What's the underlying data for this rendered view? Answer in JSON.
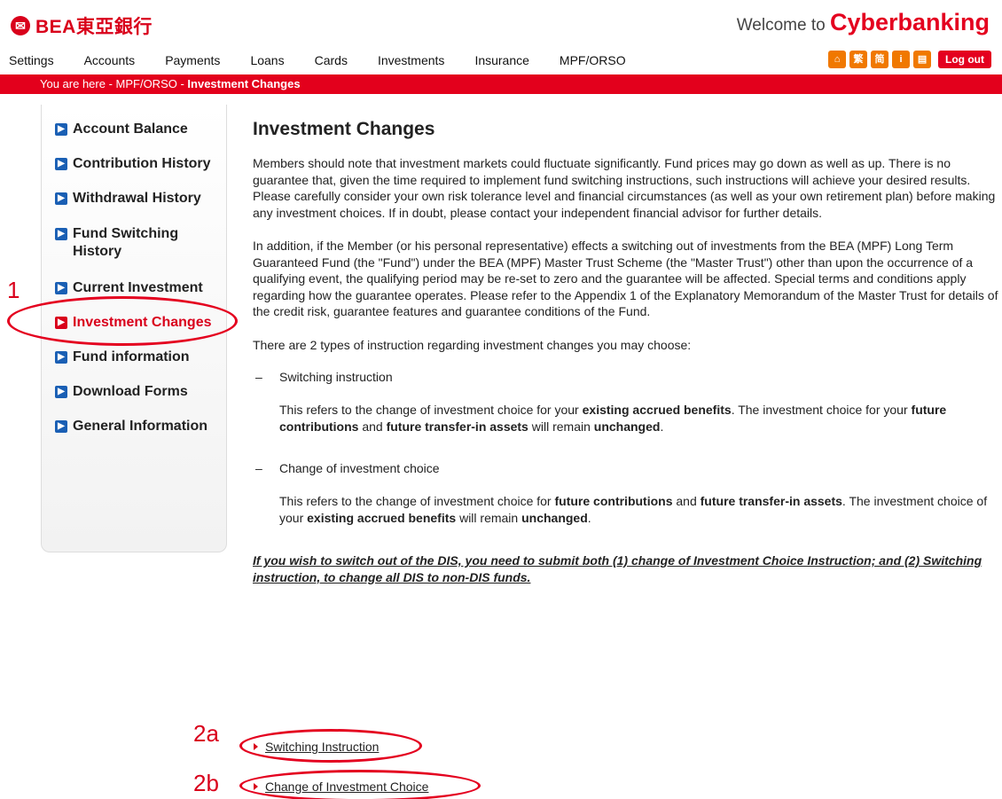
{
  "header": {
    "logo_mark": "✉",
    "logo_text": "BEA東亞銀行",
    "welcome_prefix": "Welcome to ",
    "welcome_brand": "Cyberbanking"
  },
  "nav": [
    "Settings",
    "Accounts",
    "Payments",
    "Loans",
    "Cards",
    "Investments",
    "Insurance",
    "MPF/ORSO"
  ],
  "toolbar": {
    "icons": [
      {
        "name": "home-icon",
        "glyph": "⌂"
      },
      {
        "name": "traditional-chinese-icon",
        "glyph": "繁"
      },
      {
        "name": "simplified-chinese-icon",
        "glyph": "简"
      },
      {
        "name": "info-icon",
        "glyph": "i"
      },
      {
        "name": "mailbox-icon",
        "glyph": "▤"
      }
    ],
    "logout_label": "Log out"
  },
  "breadcrumb": {
    "prefix": "You are here - MPF/ORSO - ",
    "current": "Investment Changes"
  },
  "sidebar": {
    "items": [
      {
        "label": "Account Balance"
      },
      {
        "label": "Contribution History"
      },
      {
        "label": "Withdrawal History"
      },
      {
        "label": "Fund Switching History"
      },
      {
        "label": "Current Investment"
      },
      {
        "label": "Investment Changes",
        "active": true
      },
      {
        "label": "Fund information"
      },
      {
        "label": "Download Forms"
      },
      {
        "label": "General Information"
      }
    ]
  },
  "main": {
    "title": "Investment Changes",
    "para1": "Members should note that investment markets could fluctuate significantly. Fund prices may go down as well as up. There is no guarantee that, given the time required to implement fund switching instructions, such instructions will achieve your desired results. Please carefully consider your own risk tolerance level and financial circumstances (as well as your own retirement plan) before making any investment choices. If in doubt, please contact your independent financial advisor for further details.",
    "para2": "In addition, if the Member (or his personal representative) effects a switching out of investments from the BEA (MPF) Long Term Guaranteed Fund (the \"Fund\") under the BEA (MPF) Master Trust Scheme (the \"Master Trust\") other than upon the occurrence of a qualifying event, the qualifying period may be re-set to zero and the guarantee will be affected. Special terms and conditions apply regarding how the guarantee operates. Please refer to the Appendix 1 of the Explanatory Memorandum of the Master Trust for details of the credit risk, guarantee features and guarantee conditions of the Fund.",
    "para3": "There are 2 types of instruction regarding investment changes you may choose:",
    "bullet1": "Switching instruction",
    "bullet1_desc": {
      "t1": "This refers to the change of investment choice for your ",
      "b1": "existing accrued benefits",
      "t2": ". The investment choice for your ",
      "b2": "future contributions",
      "t3": " and ",
      "b3": "future transfer-in assets",
      "t4": " will remain ",
      "b4": "unchanged",
      "t5": "."
    },
    "bullet2": "Change of investment choice",
    "bullet2_desc": {
      "t1": "This refers to the change of investment choice for ",
      "b1": "future contributions",
      "t2": " and ",
      "b2": "future transfer-in assets",
      "t3": ". The investment choice of your ",
      "b3": "existing accrued benefits",
      "t4": " will remain ",
      "b4": "unchanged",
      "t5": "."
    },
    "notice": "If you wish to switch out of the DIS, you need to submit both (1) change of Investment Choice Instruction; and (2) Switching instruction, to change all DIS to non-DIS funds.",
    "link1": "Switching Instruction",
    "link2": "Change of Investment Choice"
  },
  "annotations": {
    "a1": "1",
    "a2a": "2a",
    "a2b": "2b",
    "color": "#e4001f"
  },
  "colors": {
    "brand_red": "#e3001c",
    "nav_icon_blue": "#1a5fb4",
    "toolbar_orange": "#f07800"
  }
}
